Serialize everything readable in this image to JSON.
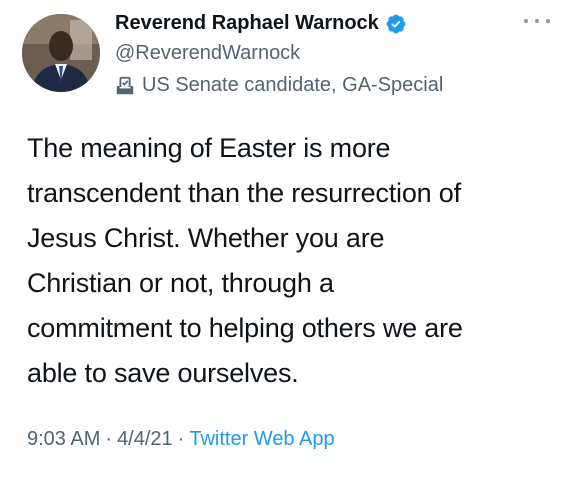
{
  "author": {
    "display_name": "Reverend Raphael Warnock",
    "handle": "@ReverendWarnock",
    "label": "US Senate candidate, GA-Special",
    "verified": true,
    "avatar_icon": "person-avatar",
    "verified_icon": "verified-badge-icon",
    "label_icon": "ballot-box-icon"
  },
  "tweet": {
    "text": "The meaning of Easter is more\ntranscendent than the resurrection of\nJesus Christ. Whether you are\nChristian or not, through a\ncommitment to helping others we are\nable to save ourselves."
  },
  "meta": {
    "time": "9:03 AM",
    "date": "4/4/21",
    "separator": "·",
    "source": "Twitter Web App"
  },
  "colors": {
    "text_primary": "#0f1419",
    "text_secondary": "#536471",
    "accent": "#1d9bf0"
  }
}
